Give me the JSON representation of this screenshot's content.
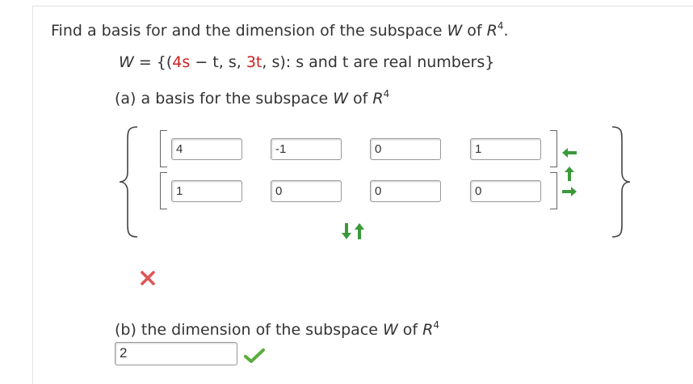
{
  "problem": {
    "prefix": "Find a basis for and the dimension of the subspace ",
    "W": "W",
    "of": " of ",
    "R": "R",
    "exp": "4",
    "period": "."
  },
  "set_def": {
    "W": "W",
    "eq_open": " = {(",
    "term1": "4s",
    "minus_t": " − t, s, ",
    "term2": "3t",
    "tail": ", s): s and t are real numbers}"
  },
  "part_a": {
    "label": "(a) a basis for the subspace ",
    "W": "W",
    "of": " of ",
    "R": "R",
    "exp": "4"
  },
  "basis": {
    "vector1": [
      "4",
      "-1",
      "0",
      "1"
    ],
    "vector2": [
      "1",
      "0",
      "0",
      "0"
    ]
  },
  "part_a_status": "incorrect",
  "part_b": {
    "label": "(b) the dimension of the subspace ",
    "W": "W",
    "of": " of ",
    "R": "R",
    "exp": "4",
    "answer": "2",
    "status": "correct"
  },
  "colors": {
    "arrow_green": "#3a9a3a",
    "check_green": "#5aac3e",
    "x_red": "#e05555",
    "highlight_red": "#cc1f1f"
  },
  "icons": {
    "row_move": [
      "arrow-left-icon",
      "arrow-up-icon",
      "arrow-right-icon"
    ],
    "vector_order": [
      "arrow-down-icon",
      "arrow-up-icon"
    ],
    "status_a": "x-icon",
    "status_b": "check-icon"
  }
}
